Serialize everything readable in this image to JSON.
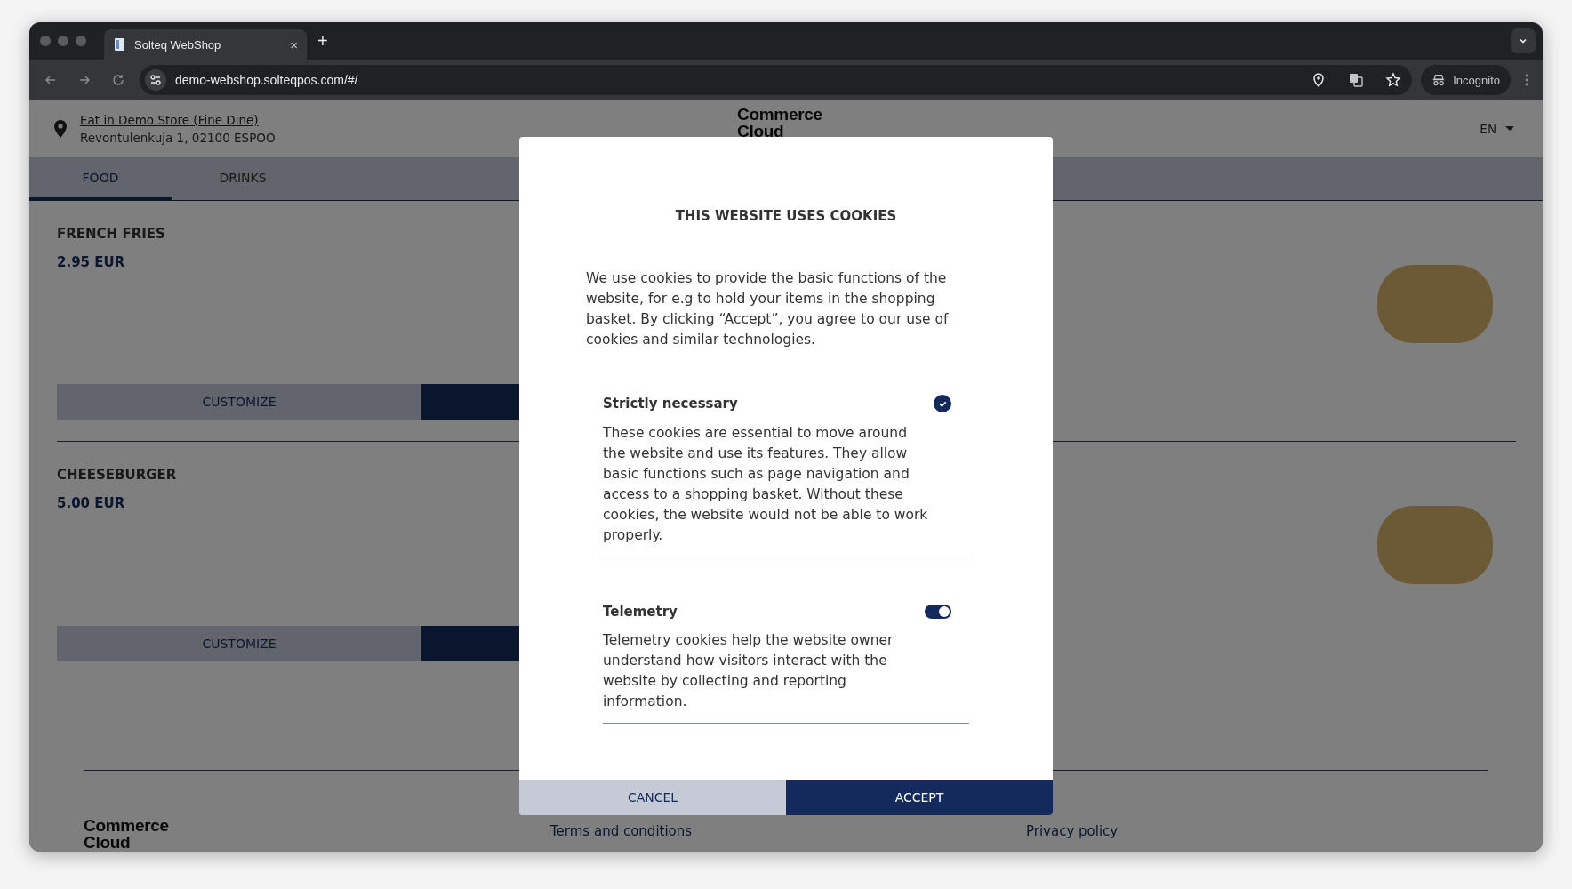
{
  "browser": {
    "tab": {
      "title": "Solteq WebShop",
      "close": "×"
    },
    "new_tab": "+",
    "url": "demo-webshop.solteqpos.com/#/",
    "profile": "Incognito"
  },
  "header": {
    "store_name": "Eat in Demo Store (Fine Dine)",
    "store_address": "Revontulenkuja 1, 02100 ESPOO",
    "logo": "Commerce Cloud",
    "language": "EN"
  },
  "tabs": [
    {
      "label": "FOOD",
      "selected": true
    },
    {
      "label": "DRINKS",
      "selected": false
    }
  ],
  "products": [
    {
      "name": "FRENCH FRIES",
      "price": "2.95 EUR",
      "customize": "CUSTOMIZE"
    },
    {
      "name": "CHEESEBURGER",
      "price": "5.00 EUR",
      "customize": "CUSTOMIZE"
    }
  ],
  "footer": {
    "logo": "Commerce Cloud",
    "links": [
      "Terms and conditions",
      "Privacy policy"
    ]
  },
  "cookie_dialog": {
    "title": "THIS WEBSITE USES COOKIES",
    "intro": "We use cookies to provide the basic functions of the website, for e.g to hold your items in the shopping basket. By clicking “Accept”, you agree to our use of cookies and similar technologies.",
    "categories": [
      {
        "kind": "check",
        "name": "Strictly necessary",
        "checked": true,
        "description": "These cookies are essential to move around the website and use its features. They allow basic functions such as page navigation and access to a shopping basket. Without these cookies, the website would not be able to work properly."
      },
      {
        "kind": "toggle",
        "name": "Telemetry",
        "on": true,
        "description": "Telemetry cookies help the website owner understand how visitors interact with the website by collecting and reporting information."
      }
    ],
    "buttons": [
      {
        "kind": "secondary",
        "label": "CANCEL"
      },
      {
        "kind": "primary",
        "label": "ACCEPT"
      }
    ]
  }
}
